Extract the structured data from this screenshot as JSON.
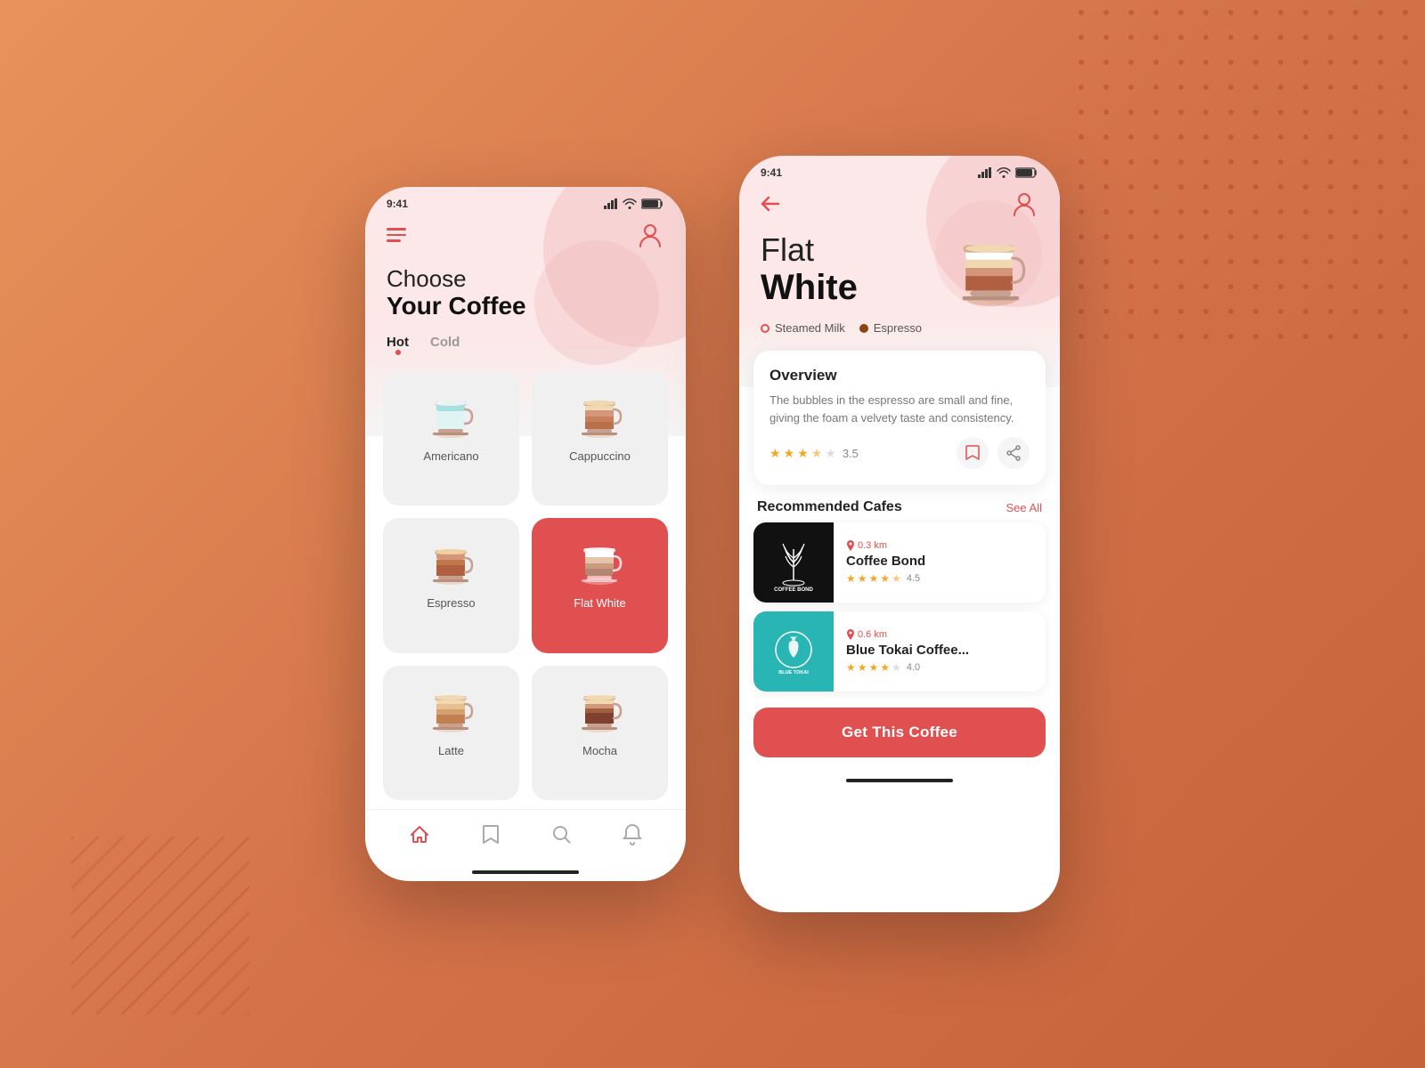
{
  "background": {
    "color": "#d4734a"
  },
  "phone1": {
    "status_time": "9:41",
    "header": {
      "menu_label": "menu",
      "profile_label": "profile"
    },
    "title_line1": "Choose",
    "title_line2": "Your Coffee",
    "tabs": [
      {
        "label": "Hot",
        "active": true
      },
      {
        "label": "Cold",
        "active": false
      }
    ],
    "coffees": [
      {
        "name": "Americano",
        "selected": false,
        "type": "americano"
      },
      {
        "name": "Cappuccino",
        "selected": false,
        "type": "cappuccino"
      },
      {
        "name": "Espresso",
        "selected": false,
        "type": "espresso"
      },
      {
        "name": "Flat White",
        "selected": true,
        "type": "flatwhite"
      },
      {
        "name": "Latte",
        "selected": false,
        "type": "latte"
      },
      {
        "name": "Mocha",
        "selected": false,
        "type": "mocha"
      }
    ],
    "nav": [
      {
        "icon": "home-icon",
        "label": "Home"
      },
      {
        "icon": "bookmark-icon",
        "label": "Saved"
      },
      {
        "icon": "search-icon",
        "label": "Search"
      },
      {
        "icon": "bell-icon",
        "label": "Notifications"
      }
    ]
  },
  "phone2": {
    "status_time": "9:41",
    "back_label": "back",
    "profile_label": "profile",
    "coffee_name_line1": "Flat",
    "coffee_name_line2": "White",
    "ingredients": [
      {
        "name": "Steamed Milk",
        "dot_type": "outline"
      },
      {
        "name": "Espresso",
        "dot_type": "filled"
      }
    ],
    "overview": {
      "title": "Overview",
      "text": "The bubbles in the espresso are small and fine, giving the foam a velvety taste and consistency.",
      "rating": "3.5",
      "save_label": "save",
      "share_label": "share"
    },
    "recommended": {
      "section_title": "Recommended Cafes",
      "see_all_label": "See All",
      "cafes": [
        {
          "name": "Coffee Bond",
          "distance": "0.3 km",
          "rating": "4.5",
          "logo_style": "black",
          "logo_text": "COFFEE BOND"
        },
        {
          "name": "Blue Tokai Coffee...",
          "distance": "0.6 km",
          "rating": "4.0",
          "logo_style": "teal",
          "logo_text": "BLUE TOKAI"
        }
      ]
    },
    "cta_label": "Get This Coffee"
  }
}
